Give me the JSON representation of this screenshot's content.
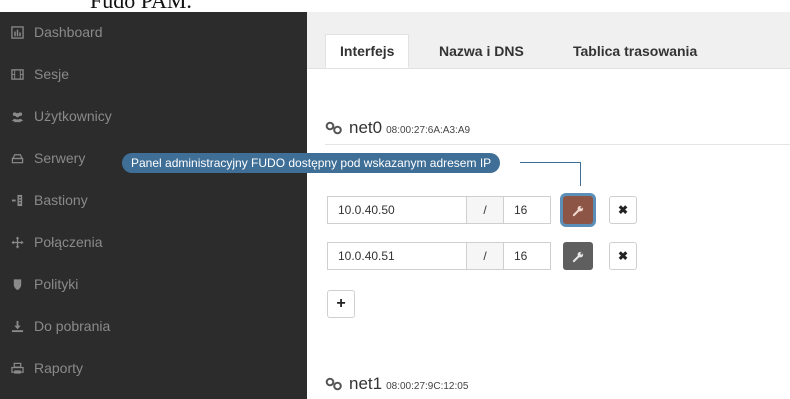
{
  "document": {
    "caption": "Fudo PAM."
  },
  "sidebar": {
    "items": [
      {
        "label": "Dashboard",
        "icon": "bar-chart-icon"
      },
      {
        "label": "Sesje",
        "icon": "film-icon"
      },
      {
        "label": "Użytkownicy",
        "icon": "users-icon"
      },
      {
        "label": "Serwery",
        "icon": "server-icon"
      },
      {
        "label": "Bastiony",
        "icon": "bastion-icon"
      },
      {
        "label": "Połączenia",
        "icon": "move-icon"
      },
      {
        "label": "Polityki",
        "icon": "shield-icon"
      },
      {
        "label": "Do pobrania",
        "icon": "download-icon"
      },
      {
        "label": "Raporty",
        "icon": "print-icon"
      }
    ]
  },
  "tabs": [
    {
      "label": "Interfejs",
      "active": true
    },
    {
      "label": "Nazwa i DNS",
      "active": false
    },
    {
      "label": "Tablica trasowania",
      "active": false
    }
  ],
  "interfaces": [
    {
      "name": "net0",
      "mac": "08:00:27:6A:A3:A9",
      "addresses": [
        {
          "ip": "10.0.40.50",
          "separator": "/",
          "prefix": "16",
          "admin_panel": true
        },
        {
          "ip": "10.0.40.51",
          "separator": "/",
          "prefix": "16",
          "admin_panel": false
        }
      ],
      "add_label": "+",
      "remove_label": "✖"
    },
    {
      "name": "net1",
      "mac": "08:00:27:9C:12:05"
    }
  ],
  "tooltip": {
    "text": "Panel administracyjny FUDO dostępny pod wskazanym adresem IP"
  },
  "colors": {
    "sidebar_bg": "#2c2c2c",
    "sidebar_text": "#8a8a8a",
    "tooltip_bg": "#3f6f97",
    "wrench_active": "#8c5546",
    "wrench_default": "#5f5f5f"
  }
}
